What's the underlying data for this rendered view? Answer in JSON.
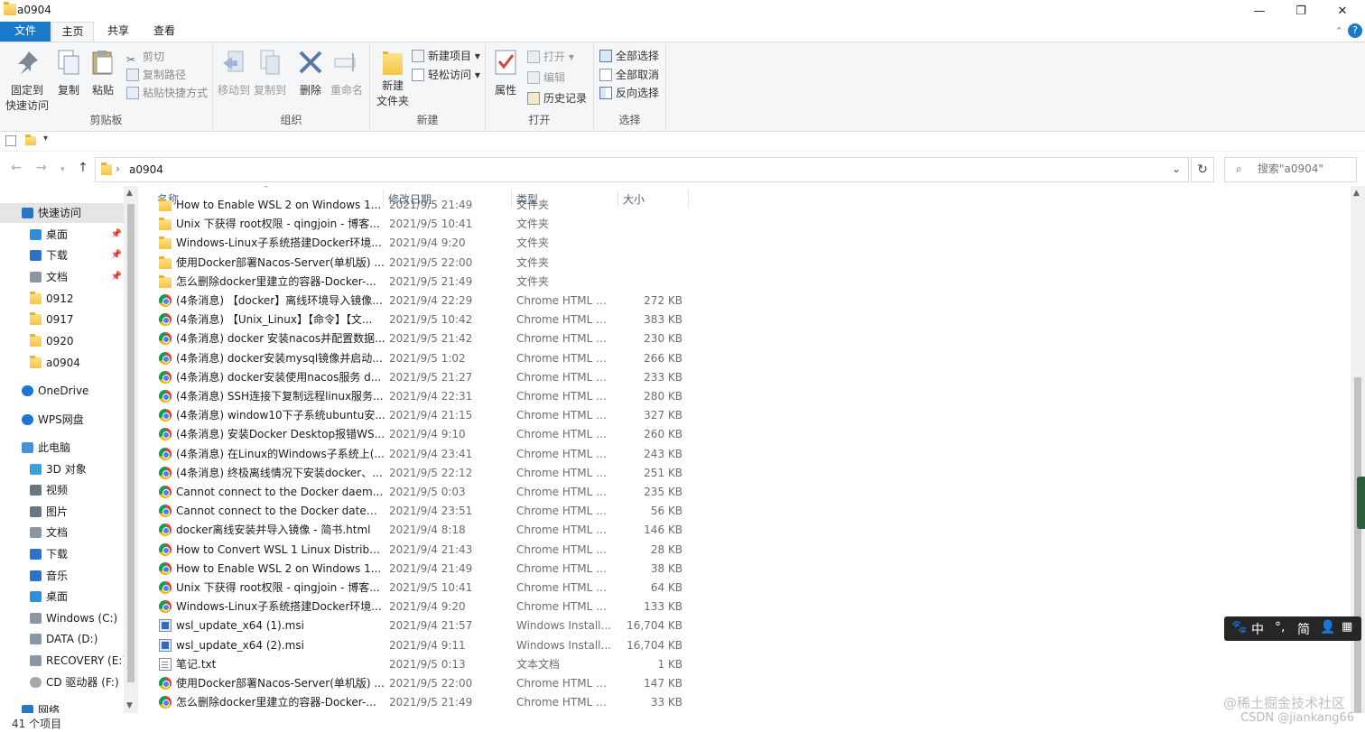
{
  "window": {
    "title": "a0904",
    "minimize_icon": "—",
    "maximize_icon": "❐",
    "close_icon": "✕"
  },
  "ribbon_tabs": [
    "文件",
    "主页",
    "共享",
    "查看"
  ],
  "ribbon": {
    "clipboard": {
      "label": "剪贴板",
      "pin_line1": "固定到",
      "pin_line2": "快速访问",
      "copy": "复制",
      "paste": "粘贴",
      "cut": "剪切",
      "copy_path": "复制路径",
      "paste_shortcut": "粘贴快捷方式"
    },
    "organize": {
      "label": "组织",
      "move_to": "移动到",
      "copy_to": "复制到",
      "delete": "删除",
      "rename": "重命名"
    },
    "new": {
      "label": "新建",
      "new_folder_line1": "新建",
      "new_folder_line2": "文件夹",
      "new_item": "新建项目",
      "easy_access": "轻松访问"
    },
    "open": {
      "label": "打开",
      "properties": "属性",
      "open": "打开",
      "edit": "编辑",
      "history": "历史记录"
    },
    "select": {
      "label": "选择",
      "select_all": "全部选择",
      "select_none": "全部取消",
      "invert": "反向选择"
    }
  },
  "address": {
    "crumb": "a0904",
    "search_placeholder": "搜索\"a0904\""
  },
  "columns": {
    "name": "名称",
    "date": "修改日期",
    "type": "类型",
    "size": "大小"
  },
  "nav": [
    {
      "label": "快速访问",
      "icon": "star-icon",
      "indent": 0,
      "pinned": false,
      "selected": true
    },
    {
      "label": "桌面",
      "icon": "desktop-icon",
      "indent": 1,
      "pinned": true,
      "selected": false
    },
    {
      "label": "下载",
      "icon": "download-icon",
      "indent": 1,
      "pinned": true,
      "selected": false
    },
    {
      "label": "文档",
      "icon": "document-icon",
      "indent": 1,
      "pinned": true,
      "selected": false
    },
    {
      "label": "0912",
      "icon": "folder-icon",
      "indent": 1,
      "pinned": false,
      "selected": false
    },
    {
      "label": "0917",
      "icon": "folder-icon",
      "indent": 1,
      "pinned": false,
      "selected": false
    },
    {
      "label": "0920",
      "icon": "folder-icon",
      "indent": 1,
      "pinned": false,
      "selected": false
    },
    {
      "label": "a0904",
      "icon": "folder-icon",
      "indent": 1,
      "pinned": false,
      "selected": false
    },
    {
      "label": "OneDrive",
      "icon": "cloud-icon",
      "indent": 0,
      "pinned": false,
      "selected": false
    },
    {
      "label": "WPS网盘",
      "icon": "cloud-icon",
      "indent": 0,
      "pinned": false,
      "selected": false
    },
    {
      "label": "此电脑",
      "icon": "computer-icon",
      "indent": 0,
      "pinned": false,
      "selected": false
    },
    {
      "label": "3D 对象",
      "icon": "3d-objects-icon",
      "indent": 1,
      "pinned": false,
      "selected": false
    },
    {
      "label": "视频",
      "icon": "video-icon",
      "indent": 1,
      "pinned": false,
      "selected": false
    },
    {
      "label": "图片",
      "icon": "picture-icon",
      "indent": 1,
      "pinned": false,
      "selected": false
    },
    {
      "label": "文档",
      "icon": "document-icon",
      "indent": 1,
      "pinned": false,
      "selected": false
    },
    {
      "label": "下载",
      "icon": "download-icon",
      "indent": 1,
      "pinned": false,
      "selected": false
    },
    {
      "label": "音乐",
      "icon": "music-icon",
      "indent": 1,
      "pinned": false,
      "selected": false
    },
    {
      "label": "桌面",
      "icon": "desktop-icon",
      "indent": 1,
      "pinned": false,
      "selected": false
    },
    {
      "label": "Windows (C:)",
      "icon": "drive-icon",
      "indent": 1,
      "pinned": false,
      "selected": false
    },
    {
      "label": "DATA (D:)",
      "icon": "drive-icon",
      "indent": 1,
      "pinned": false,
      "selected": false
    },
    {
      "label": "RECOVERY (E:)",
      "icon": "drive-icon",
      "indent": 1,
      "pinned": false,
      "selected": false
    },
    {
      "label": "CD 驱动器 (F:)",
      "icon": "cd-drive-icon",
      "indent": 1,
      "pinned": false,
      "selected": false
    },
    {
      "label": "网络",
      "icon": "network-icon",
      "indent": 0,
      "pinned": false,
      "selected": false
    }
  ],
  "files": [
    {
      "name": "How to Enable WSL 2 on Windows 1...",
      "date": "2021/9/5 21:49",
      "type": "文件夹",
      "size": "",
      "icon": "folder"
    },
    {
      "name": "Unix 下获得 root权限 - qingjoin - 博客...",
      "date": "2021/9/5 10:41",
      "type": "文件夹",
      "size": "",
      "icon": "folder"
    },
    {
      "name": "Windows-Linux子系统搭建Docker环境...",
      "date": "2021/9/4 9:20",
      "type": "文件夹",
      "size": "",
      "icon": "folder"
    },
    {
      "name": "使用Docker部署Nacos-Server(单机版) ...",
      "date": "2021/9/5 22:00",
      "type": "文件夹",
      "size": "",
      "icon": "folder"
    },
    {
      "name": "怎么删除docker里建立的容器-Docker-...",
      "date": "2021/9/5 21:49",
      "type": "文件夹",
      "size": "",
      "icon": "folder"
    },
    {
      "name": "(4条消息) 【docker】离线环境导入镜像...",
      "date": "2021/9/4 22:29",
      "type": "Chrome HTML D...",
      "size": "272 KB",
      "icon": "chrome"
    },
    {
      "name": "(4条消息) 【Unix_Linux】【命令】【文...",
      "date": "2021/9/5 10:42",
      "type": "Chrome HTML D...",
      "size": "383 KB",
      "icon": "chrome"
    },
    {
      "name": "(4条消息) docker 安装nacos并配置数据...",
      "date": "2021/9/5 21:42",
      "type": "Chrome HTML D...",
      "size": "230 KB",
      "icon": "chrome"
    },
    {
      "name": "(4条消息) docker安装mysql镜像并启动...",
      "date": "2021/9/5 1:02",
      "type": "Chrome HTML D...",
      "size": "266 KB",
      "icon": "chrome"
    },
    {
      "name": "(4条消息) docker安装使用nacos服务 d...",
      "date": "2021/9/5 21:27",
      "type": "Chrome HTML D...",
      "size": "233 KB",
      "icon": "chrome"
    },
    {
      "name": "(4条消息) SSH连接下复制远程linux服务...",
      "date": "2021/9/4 22:31",
      "type": "Chrome HTML D...",
      "size": "280 KB",
      "icon": "chrome"
    },
    {
      "name": "(4条消息) window10下子系统ubuntu安...",
      "date": "2021/9/4 21:15",
      "type": "Chrome HTML D...",
      "size": "327 KB",
      "icon": "chrome"
    },
    {
      "name": "(4条消息) 安装Docker Desktop报错WS...",
      "date": "2021/9/4 9:10",
      "type": "Chrome HTML D...",
      "size": "260 KB",
      "icon": "chrome"
    },
    {
      "name": "(4条消息) 在Linux的Windows子系统上(...",
      "date": "2021/9/4 23:41",
      "type": "Chrome HTML D...",
      "size": "243 KB",
      "icon": "chrome"
    },
    {
      "name": "(4条消息) 终极离线情况下安装docker、...",
      "date": "2021/9/5 22:12",
      "type": "Chrome HTML D...",
      "size": "251 KB",
      "icon": "chrome"
    },
    {
      "name": "Cannot connect to the Docker daem...",
      "date": "2021/9/5 0:03",
      "type": "Chrome HTML D...",
      "size": "235 KB",
      "icon": "chrome"
    },
    {
      "name": "Cannot connect to the Docker datem...",
      "date": "2021/9/4 23:51",
      "type": "Chrome HTML D...",
      "size": "56 KB",
      "icon": "chrome"
    },
    {
      "name": "docker离线安装并导入镜像 - 简书.html",
      "date": "2021/9/4 8:18",
      "type": "Chrome HTML D...",
      "size": "146 KB",
      "icon": "chrome"
    },
    {
      "name": "How to Convert WSL 1 Linux Distribu...",
      "date": "2021/9/4 21:43",
      "type": "Chrome HTML D...",
      "size": "28 KB",
      "icon": "chrome"
    },
    {
      "name": "How to Enable WSL 2 on Windows 1...",
      "date": "2021/9/4 21:49",
      "type": "Chrome HTML D...",
      "size": "38 KB",
      "icon": "chrome"
    },
    {
      "name": "Unix 下获得 root权限 - qingjoin - 博客...",
      "date": "2021/9/5 10:41",
      "type": "Chrome HTML D...",
      "size": "64 KB",
      "icon": "chrome"
    },
    {
      "name": "Windows-Linux子系统搭建Docker环境...",
      "date": "2021/9/4 9:20",
      "type": "Chrome HTML D...",
      "size": "133 KB",
      "icon": "chrome"
    },
    {
      "name": "wsl_update_x64 (1).msi",
      "date": "2021/9/4 21:57",
      "type": "Windows Install...",
      "size": "16,704 KB",
      "icon": "msi"
    },
    {
      "name": "wsl_update_x64 (2).msi",
      "date": "2021/9/4 9:11",
      "type": "Windows Install...",
      "size": "16,704 KB",
      "icon": "msi"
    },
    {
      "name": "笔记.txt",
      "date": "2021/9/5 0:13",
      "type": "文本文档",
      "size": "1 KB",
      "icon": "txt"
    },
    {
      "name": "使用Docker部署Nacos-Server(单机版) ...",
      "date": "2021/9/5 22:00",
      "type": "Chrome HTML D...",
      "size": "147 KB",
      "icon": "chrome"
    },
    {
      "name": "怎么删除docker里建立的容器-Docker-...",
      "date": "2021/9/5 21:49",
      "type": "Chrome HTML D...",
      "size": "33 KB",
      "icon": "chrome"
    }
  ],
  "status": {
    "count": "41 个项目"
  },
  "ime": {
    "mode": "中",
    "punct": "°,",
    "simplified": "简"
  },
  "watermark": {
    "line1": "@稀土掘金技术社区",
    "line2": "CSDN @jiankang66"
  },
  "colors": {
    "accent": "#1979ca",
    "ribbon_bg": "#f5f6f7",
    "selected_nav": "#e5e5e5"
  }
}
